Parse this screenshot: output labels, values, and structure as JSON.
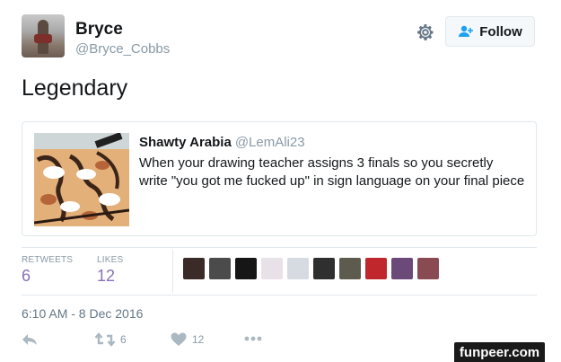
{
  "author": {
    "name": "Bryce",
    "handle": "@Bryce_Cobbs"
  },
  "follow_label": "Follow",
  "tweet": {
    "text": "Legendary",
    "timestamp": "6:10 AM - 8 Dec 2016"
  },
  "quote": {
    "author_name": "Shawty Arabia",
    "author_handle": "@LemAli23",
    "body": "When your drawing teacher assigns 3 finals so you secretly write \"you got me fucked up\" in sign language on your final piece"
  },
  "stats": {
    "retweets_label": "RETWEETS",
    "retweets_value": "6",
    "likes_label": "LIKES",
    "likes_value": "12"
  },
  "likers": [
    {
      "name": "liker-avatar-1",
      "color": "#3a2a28"
    },
    {
      "name": "liker-avatar-2",
      "color": "#4b4b4b"
    },
    {
      "name": "liker-avatar-3",
      "color": "#161616"
    },
    {
      "name": "liker-avatar-4",
      "color": "#e8e2e8"
    },
    {
      "name": "liker-avatar-5",
      "color": "#d6dbe2"
    },
    {
      "name": "liker-avatar-6",
      "color": "#2f2f2f"
    },
    {
      "name": "liker-avatar-7",
      "color": "#5d5a4e"
    },
    {
      "name": "liker-avatar-8",
      "color": "#c0272d"
    },
    {
      "name": "liker-avatar-9",
      "color": "#6b4a7a"
    },
    {
      "name": "liker-avatar-10",
      "color": "#8a4a52"
    }
  ],
  "actions": {
    "reply_icon": "reply-icon",
    "retweet_icon": "retweet-icon",
    "retweet_count": "6",
    "like_icon": "heart-icon",
    "like_count": "12",
    "more_icon": "more-icon"
  },
  "watermark": "funpeer.com",
  "colors": {
    "stat_value": "#8a6fb8",
    "muted": "#8899a6",
    "border": "#e1e8ed"
  }
}
